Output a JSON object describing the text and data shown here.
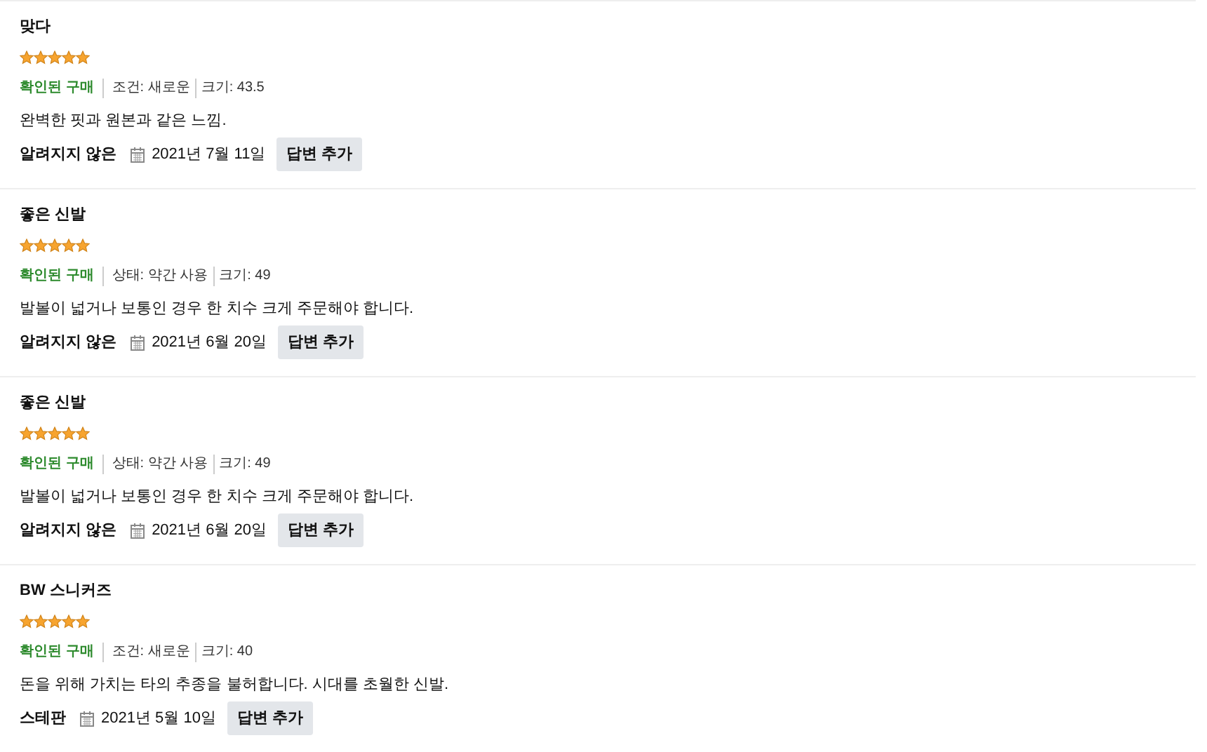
{
  "reviews": [
    {
      "title": "맞다",
      "stars": 5,
      "verified": "확인된 구매",
      "condition": "조건: 새로운",
      "size": "크기: 43.5",
      "text": "완벽한 핏과 원본과 같은 느낌.",
      "author": "알려지지 않은",
      "date": "2021년 7월 11일",
      "reply_button": "답변 추가"
    },
    {
      "title": "좋은 신발",
      "stars": 5,
      "verified": "확인된 구매",
      "condition": "상태: 약간 사용",
      "size": "크기: 49",
      "text": "발볼이 넓거나 보통인 경우 한 치수 크게 주문해야 합니다.",
      "author": "알려지지 않은",
      "date": "2021년 6월 20일",
      "reply_button": "답변 추가"
    },
    {
      "title": "좋은 신발",
      "stars": 5,
      "verified": "확인된 구매",
      "condition": "상태: 약간 사용",
      "size": "크기: 49",
      "text": "발볼이 넓거나 보통인 경우 한 치수 크게 주문해야 합니다.",
      "author": "알려지지 않은",
      "date": "2021년 6월 20일",
      "reply_button": "답변 추가"
    },
    {
      "title": "BW 스니커즈",
      "stars": 5,
      "verified": "확인된 구매",
      "condition": "조건: 새로운",
      "size": "크기: 40",
      "text": "돈을 위해 가치는 타의 추종을 불허합니다. 시대를 초월한 신발.",
      "author": "스테판",
      "date": "2021년 5월 10일",
      "reply_button": "답변 추가"
    }
  ]
}
